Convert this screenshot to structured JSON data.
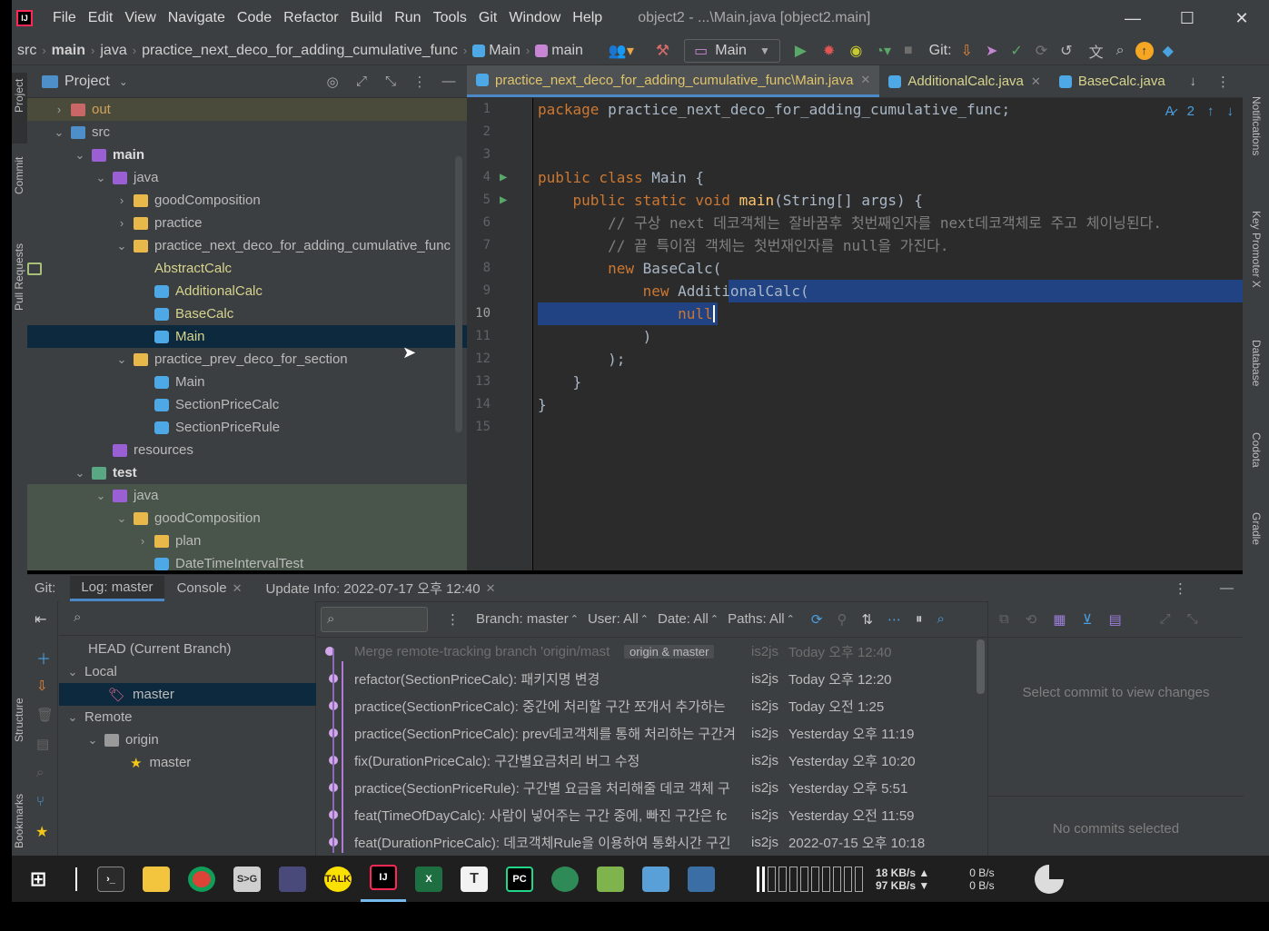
{
  "app": {
    "menu": [
      "File",
      "Edit",
      "View",
      "Navigate",
      "Code",
      "Refactor",
      "Build",
      "Run",
      "Tools",
      "Git",
      "Window",
      "Help"
    ],
    "window_title": "object2 - ...\\Main.java [object2.main]"
  },
  "navbar": {
    "crumbs": [
      "src",
      "main",
      "java",
      "practice_next_deco_for_adding_cumulative_func",
      "Main",
      "main"
    ],
    "run_config": "Main",
    "git_label": "Git:"
  },
  "left_stripe": {
    "project": "Project",
    "commit": "Commit",
    "pull_requests": "Pull Requests",
    "structure": "Structure",
    "bookmarks": "Bookmarks"
  },
  "right_stripe": {
    "notifications": "Notifications",
    "key_promoter": "Key Promoter X",
    "database": "Database",
    "codota": "Codota",
    "gradle": "Gradle"
  },
  "project_panel": {
    "title": "Project",
    "tree": [
      {
        "label": "out",
        "depth": 0,
        "arrow": "›",
        "kind": "exfolder",
        "style": "excluded"
      },
      {
        "label": "src",
        "depth": 0,
        "arrow": "⌄",
        "kind": "srcfolder"
      },
      {
        "label": "main",
        "depth": 1,
        "arrow": "⌄",
        "kind": "modfolder",
        "bold": true
      },
      {
        "label": "java",
        "depth": 2,
        "arrow": "⌄",
        "kind": "modfolder"
      },
      {
        "label": "goodComposition",
        "depth": 3,
        "arrow": "›",
        "kind": "folder"
      },
      {
        "label": "practice",
        "depth": 3,
        "arrow": "›",
        "kind": "folder"
      },
      {
        "label": "practice_next_deco_for_adding_cumulative_func",
        "depth": 3,
        "arrow": "⌄",
        "kind": "folder"
      },
      {
        "label": "AbstractCalc",
        "depth": 4,
        "arrow": "",
        "kind": "abs",
        "color": "#d7d48d"
      },
      {
        "label": "AdditionalCalc",
        "depth": 4,
        "arrow": "",
        "kind": "cls",
        "color": "#d7d48d"
      },
      {
        "label": "BaseCalc",
        "depth": 4,
        "arrow": "",
        "kind": "cls",
        "color": "#d7d48d"
      },
      {
        "label": "Main",
        "depth": 4,
        "arrow": "",
        "kind": "cls",
        "color": "#d7d48d",
        "style": "selected"
      },
      {
        "label": "practice_prev_deco_for_section",
        "depth": 3,
        "arrow": "⌄",
        "kind": "folder"
      },
      {
        "label": "Main",
        "depth": 4,
        "arrow": "",
        "kind": "cls"
      },
      {
        "label": "SectionPriceCalc",
        "depth": 4,
        "arrow": "",
        "kind": "cls"
      },
      {
        "label": "SectionPriceRule",
        "depth": 4,
        "arrow": "",
        "kind": "cls"
      },
      {
        "label": "resources",
        "depth": 2,
        "arrow": "",
        "kind": "modfolder"
      },
      {
        "label": "test",
        "depth": 1,
        "arrow": "⌄",
        "kind": "testfolder",
        "bold": true
      },
      {
        "label": "java",
        "depth": 2,
        "arrow": "⌄",
        "kind": "modfolder",
        "style": "test"
      },
      {
        "label": "goodComposition",
        "depth": 3,
        "arrow": "⌄",
        "kind": "folder",
        "style": "test"
      },
      {
        "label": "plan",
        "depth": 4,
        "arrow": "›",
        "kind": "folder",
        "style": "test"
      },
      {
        "label": "DateTimeIntervalTest",
        "depth": 4,
        "arrow": "",
        "kind": "cls",
        "style": "test"
      }
    ]
  },
  "editor": {
    "tabs": [
      {
        "label": "practice_next_deco_for_adding_cumulative_func\\Main.java",
        "active": true
      },
      {
        "label": "AdditionalCalc.java",
        "active": false
      },
      {
        "label": "BaseCalc.java",
        "active": false
      }
    ],
    "inspection_count": "2",
    "lines": [
      "1",
      "2",
      "3",
      "4",
      "5",
      "6",
      "7",
      "8",
      "9",
      "10",
      "11",
      "12",
      "13",
      "14",
      "15"
    ],
    "code": {
      "l1_kw": "package",
      "l1_rest": " practice_next_deco_for_adding_cumulative_func;",
      "l4_kw": "public class",
      "l4_rest": " Main {",
      "l5_kw": "public static void",
      "l5_fn": "main",
      "l5_rest": "(String[] args) {",
      "l6": "// 구상 next 데코객체는 잘바꿈후 첫번째인자를 next데코객체로 주고 체이닝된다.",
      "l7": "// 끝 특이점 객체는 첫번재인자를 null을 가진다.",
      "l8_kw": "new",
      "l8_rest": " BaseCalc(",
      "l9_kw": "new",
      "l9_rest": " AdditionalCalc(",
      "l10_kw": "null",
      "l11": ")",
      "l12": ");",
      "l13": "}",
      "l14": "}"
    }
  },
  "bottom": {
    "tabs": {
      "git": "Git:",
      "log": "Log: master",
      "console": "Console",
      "update": "Update Info: 2022-07-17 오후 12:40"
    },
    "branches": {
      "head": "HEAD (Current Branch)",
      "local": "Local",
      "local_master": "master",
      "remote": "Remote",
      "origin": "origin",
      "origin_master": "master"
    },
    "log_toolbar": {
      "branch": "Branch: master",
      "user": "User: All",
      "date": "Date: All",
      "paths": "Paths: All"
    },
    "log_rows": [
      {
        "msg": "Merge remote-tracking branch 'origin/mast",
        "tag": "origin & master",
        "au": "is2js",
        "dt": "Today 오후 12:40",
        "dim": true
      },
      {
        "msg": "refactor(SectionPriceCalc): 패키지명 변경",
        "au": "is2js",
        "dt": "Today 오후 12:20"
      },
      {
        "msg": "practice(SectionPriceCalc): 중간에 처리할 구간 쪼개서 추가하는",
        "au": "is2js",
        "dt": "Today 오전 1:25"
      },
      {
        "msg": "practice(SectionPriceCalc): prev데코객체를 통해 처리하는 구간겨",
        "au": "is2js",
        "dt": "Yesterday 오후 11:19"
      },
      {
        "msg": "fix(DurationPriceCalc): 구간별요금처리 버그 수정",
        "au": "is2js",
        "dt": "Yesterday 오후 10:20"
      },
      {
        "msg": "practice(SectionPriceRule): 구간별 요금을 처리해줄 데코 객체 구",
        "au": "is2js",
        "dt": "Yesterday 오후 5:51"
      },
      {
        "msg": "feat(TimeOfDayCalc): 사람이 넣어주는 구간 중에, 빠진 구간은 fc",
        "au": "is2js",
        "dt": "Yesterday 오전 11:59"
      },
      {
        "msg": "feat(DurationPriceCalc): 데코객체Rule을 이용하여 통화시간 구긴",
        "au": "is2js",
        "dt": "2022-07-15 오후 10:18"
      }
    ],
    "details": {
      "select_commit": "Select commit to view changes",
      "no_commits": "No commits selected"
    }
  },
  "taskbar": {
    "apps": [
      "terminal",
      "explorer",
      "chrome",
      "ssg",
      "vm",
      "kakaotalk",
      "intellij",
      "excel",
      "typora",
      "pycharm",
      "rocket",
      "editor",
      "paint",
      "calculator"
    ],
    "net_up": "18 KB/s",
    "net_down": "97 KB/s",
    "disk_r": "0 B/s",
    "disk_w": "0 B/s",
    "kakaotalk_label": "TALK",
    "intellij_label": "IJ",
    "excel_label": "X",
    "typora_label": "T",
    "pycharm_label": "PC",
    "ssg_label": "S>G"
  }
}
